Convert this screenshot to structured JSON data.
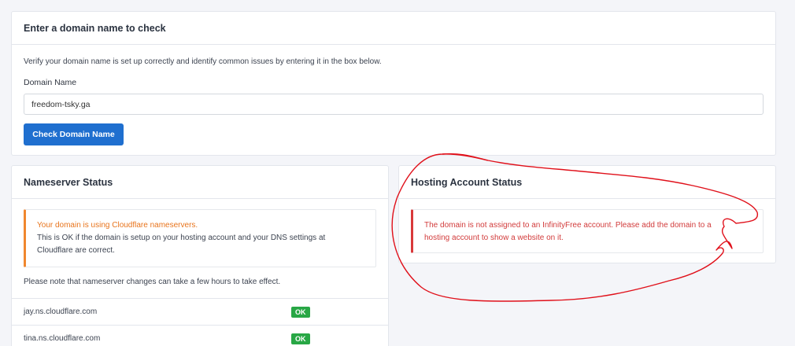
{
  "check_card": {
    "title": "Enter a domain name to check",
    "intro": "Verify your domain name is set up correctly and identify common issues by entering it in the box below.",
    "field_label": "Domain Name",
    "domain_value": "freedom-tsky.ga",
    "button_label": "Check Domain Name"
  },
  "nameserver_card": {
    "title": "Nameserver Status",
    "alert_title": "Your domain is using Cloudflare nameservers.",
    "alert_line1": "This is OK if the domain is setup on your hosting account and your DNS settings at",
    "alert_line2": "Cloudflare are correct.",
    "note": "Please note that nameserver changes can take a few hours to take effect.",
    "rows": [
      {
        "name": "jay.ns.cloudflare.com",
        "status": "OK"
      },
      {
        "name": "tina.ns.cloudflare.com",
        "status": "OK"
      }
    ]
  },
  "hosting_card": {
    "title": "Hosting Account Status",
    "alert_line1": "The domain is not assigned to an InfinityFree account. Please add the domain to a",
    "alert_line2": "hosting account to show a website on it."
  },
  "colors": {
    "primary": "#1f6fcf",
    "warning": "#f0872e",
    "danger": "#d9383a",
    "success": "#28a745",
    "annotation": "#e0101a"
  }
}
